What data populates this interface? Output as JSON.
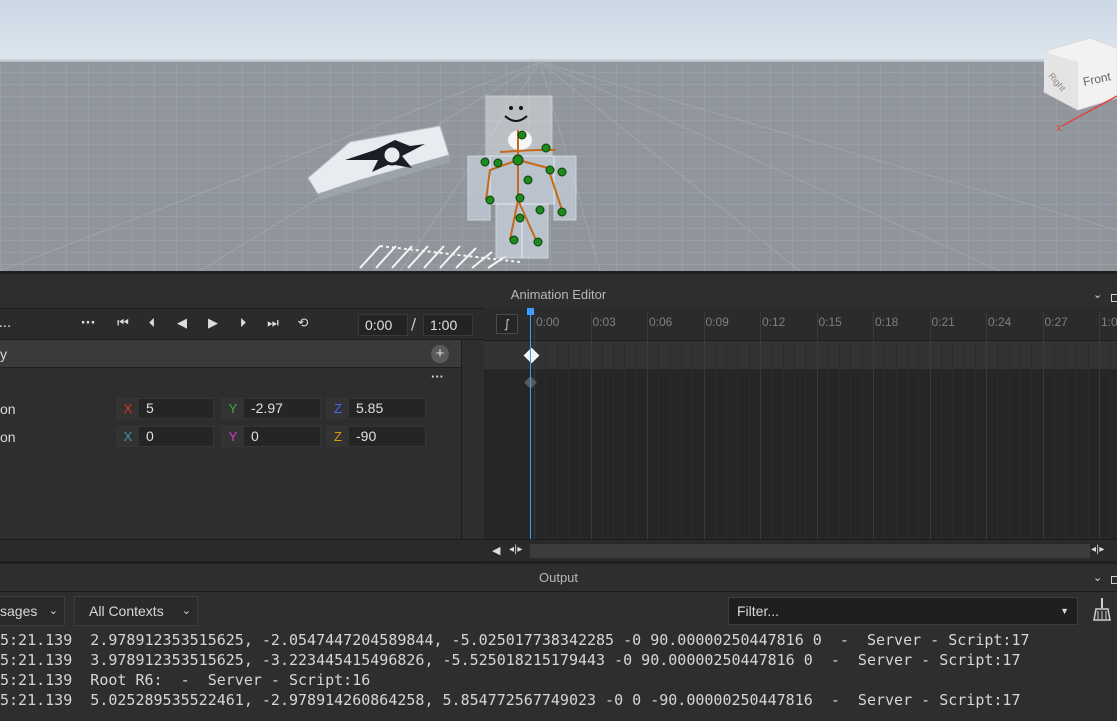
{
  "viewport": {
    "view_cube": {
      "labels": [
        "Front",
        "Right"
      ],
      "axis_label": "x"
    }
  },
  "animation_editor": {
    "title": "Animation Editor",
    "toolbar": {
      "more_left": "...",
      "more": "···",
      "current_time": "0:00",
      "separator": "/",
      "end_time": "1:00"
    },
    "tracks": {
      "root_label": "y",
      "more_label": "···",
      "position": {
        "label": "on",
        "x": {
          "tag": "X",
          "value": "5"
        },
        "y": {
          "tag": "Y",
          "value": "-2.97"
        },
        "z": {
          "tag": "Z",
          "value": "5.85"
        }
      },
      "rotation": {
        "label": "on",
        "x": {
          "tag": "X",
          "value": "0"
        },
        "y": {
          "tag": "Y",
          "value": "0"
        },
        "z": {
          "tag": "Z",
          "value": "-90"
        }
      }
    },
    "timeline_ticks": [
      "0:00",
      "0:03",
      "0:06",
      "0:09",
      "0:12",
      "0:15",
      "0:18",
      "0:21",
      "0:24",
      "0:27",
      "1:0"
    ],
    "colors": {
      "playhead": "#3aa0ff",
      "x": "#e0302c",
      "y": "#3ab24a",
      "z": "#3f68f0",
      "rx": "#3c9aa0",
      "ry": "#d040c8",
      "rz": "#e0941a"
    }
  },
  "output": {
    "title": "Output",
    "messages_dropdown": "sages",
    "contexts_dropdown": "All Contexts",
    "filter_placeholder": "Filter...",
    "lines": [
      "5:21.139  2.978912353515625, -2.0547447204589844, -5.025017738342285 -0 90.00000250447816 0  -  Server - Script:17",
      "5:21.139  3.978912353515625, -3.223445415496826, -5.525018215179443 -0 90.00000250447816 0  -  Server - Script:17",
      "5:21.139  Root R6:  -  Server - Script:16",
      "5:21.139  5.025289535522461, -2.978914260864258, 5.854772567749023 -0 0 -90.00000250447816  -  Server - Script:17"
    ]
  }
}
